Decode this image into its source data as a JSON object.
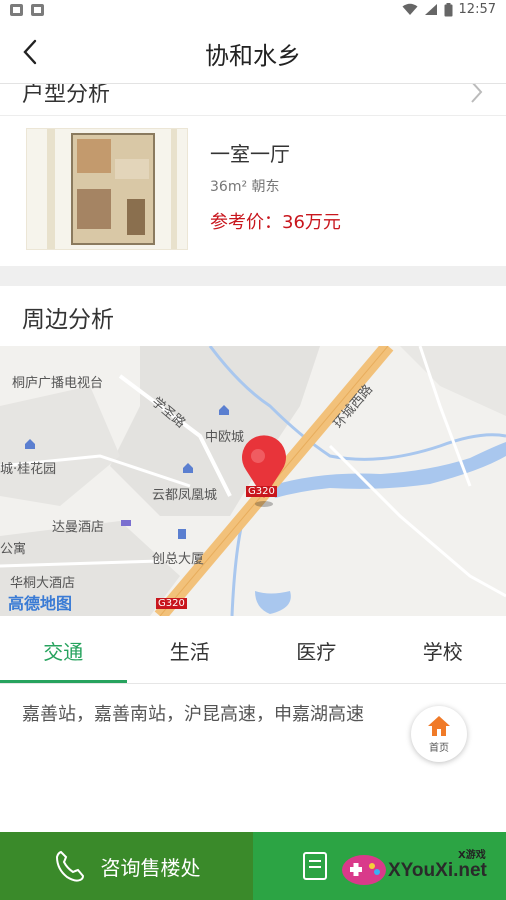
{
  "status_bar": {
    "time": "12:57"
  },
  "header": {
    "title": "协和水乡"
  },
  "house_type": {
    "section_title": "户型分析",
    "item": {
      "name": "一室一厅",
      "spec": "36m² 朝东",
      "price": "参考价：36万元"
    }
  },
  "surroundings": {
    "section_title": "周边分析",
    "map": {
      "provider_logo": "高德地图",
      "labels": {
        "tv_station": "桐庐广播电视台",
        "xuesheng_road": "学圣路",
        "zhongouc": "中欧城",
        "guihuayuan": "城·桂花园",
        "yundu": "云都凤凰城",
        "huanchengxilu": "环城西路",
        "dahao_hotel": "达曼酒店",
        "gongyu": "公寓",
        "chuangzong": "创总大厦",
        "huatong_hotel": "华桐大酒店",
        "g320_a": "G320",
        "g320_b": "G320"
      }
    },
    "tabs": [
      {
        "label": "交通",
        "active": true
      },
      {
        "label": "生活",
        "active": false
      },
      {
        "label": "医疗",
        "active": false
      },
      {
        "label": "学校",
        "active": false
      }
    ],
    "content": "嘉善站，嘉善南站，沪昆高速，申嘉湖高速"
  },
  "floating_home": {
    "label": "首页"
  },
  "bottom_bar": {
    "consult_label": "咨询售楼处",
    "watermark_text": "XYouXi.net",
    "watermark_small": "X游戏"
  },
  "colors": {
    "accent_green": "#27a35e",
    "price_red": "#c8161d",
    "consult_green": "#3a8a2a",
    "right_green": "#2ca444"
  }
}
